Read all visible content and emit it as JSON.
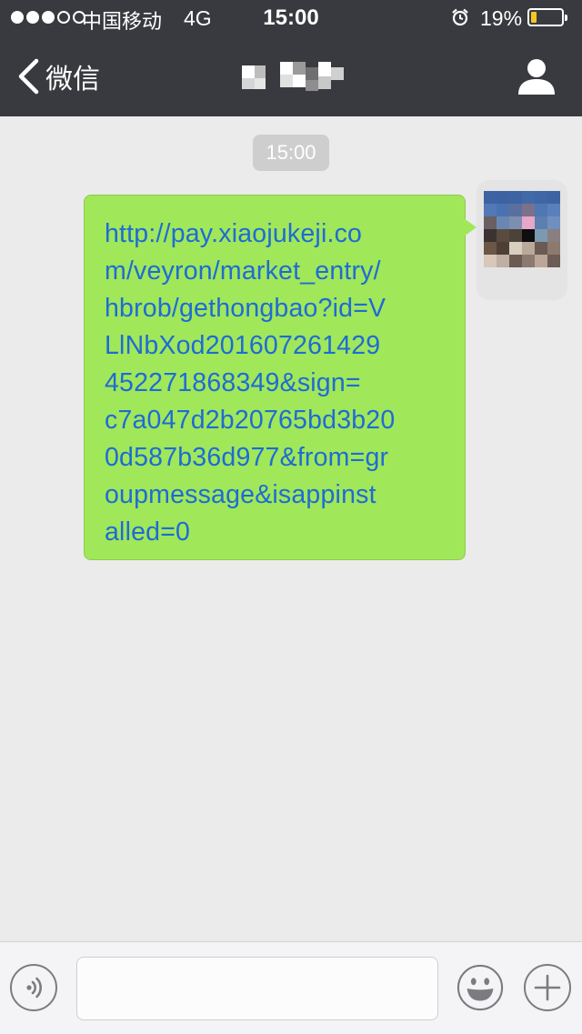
{
  "status_bar": {
    "carrier": "中国移动",
    "network": "4G",
    "time": "15:00",
    "battery_percent": "19%",
    "battery_level": 0.19,
    "battery_color": "#f6c522",
    "signal_strength": 3,
    "icons": [
      "signal-icon",
      "alarm-icon",
      "battery-icon"
    ]
  },
  "nav": {
    "back_label": "微信",
    "back_icon": "chevron-left-icon",
    "profile_icon": "person-icon"
  },
  "chat": {
    "timestamp": "15:00",
    "messages": [
      {
        "sender": "self",
        "text": "http://pay.xiaojukeji.co\nm/veyron/market_entry/\nhbrob/gethongbao?id=V\nLlNbXod201607261429\n452271868349&sign=\nc7a047d2b20765bd3b20\n0d587b36d977&from=gr\noupmessage&isappinst\nalled=0"
      }
    ]
  },
  "input_bar": {
    "input_value": "",
    "voice_icon": "voice-icon",
    "emoji_icon": "emoji-icon",
    "plus_icon": "plus-icon"
  },
  "colors": {
    "nav_background": "#393a3f",
    "chat_background": "#ebebeb",
    "bubble_background": "#a0e75a",
    "link_color": "#1e6bd6"
  }
}
